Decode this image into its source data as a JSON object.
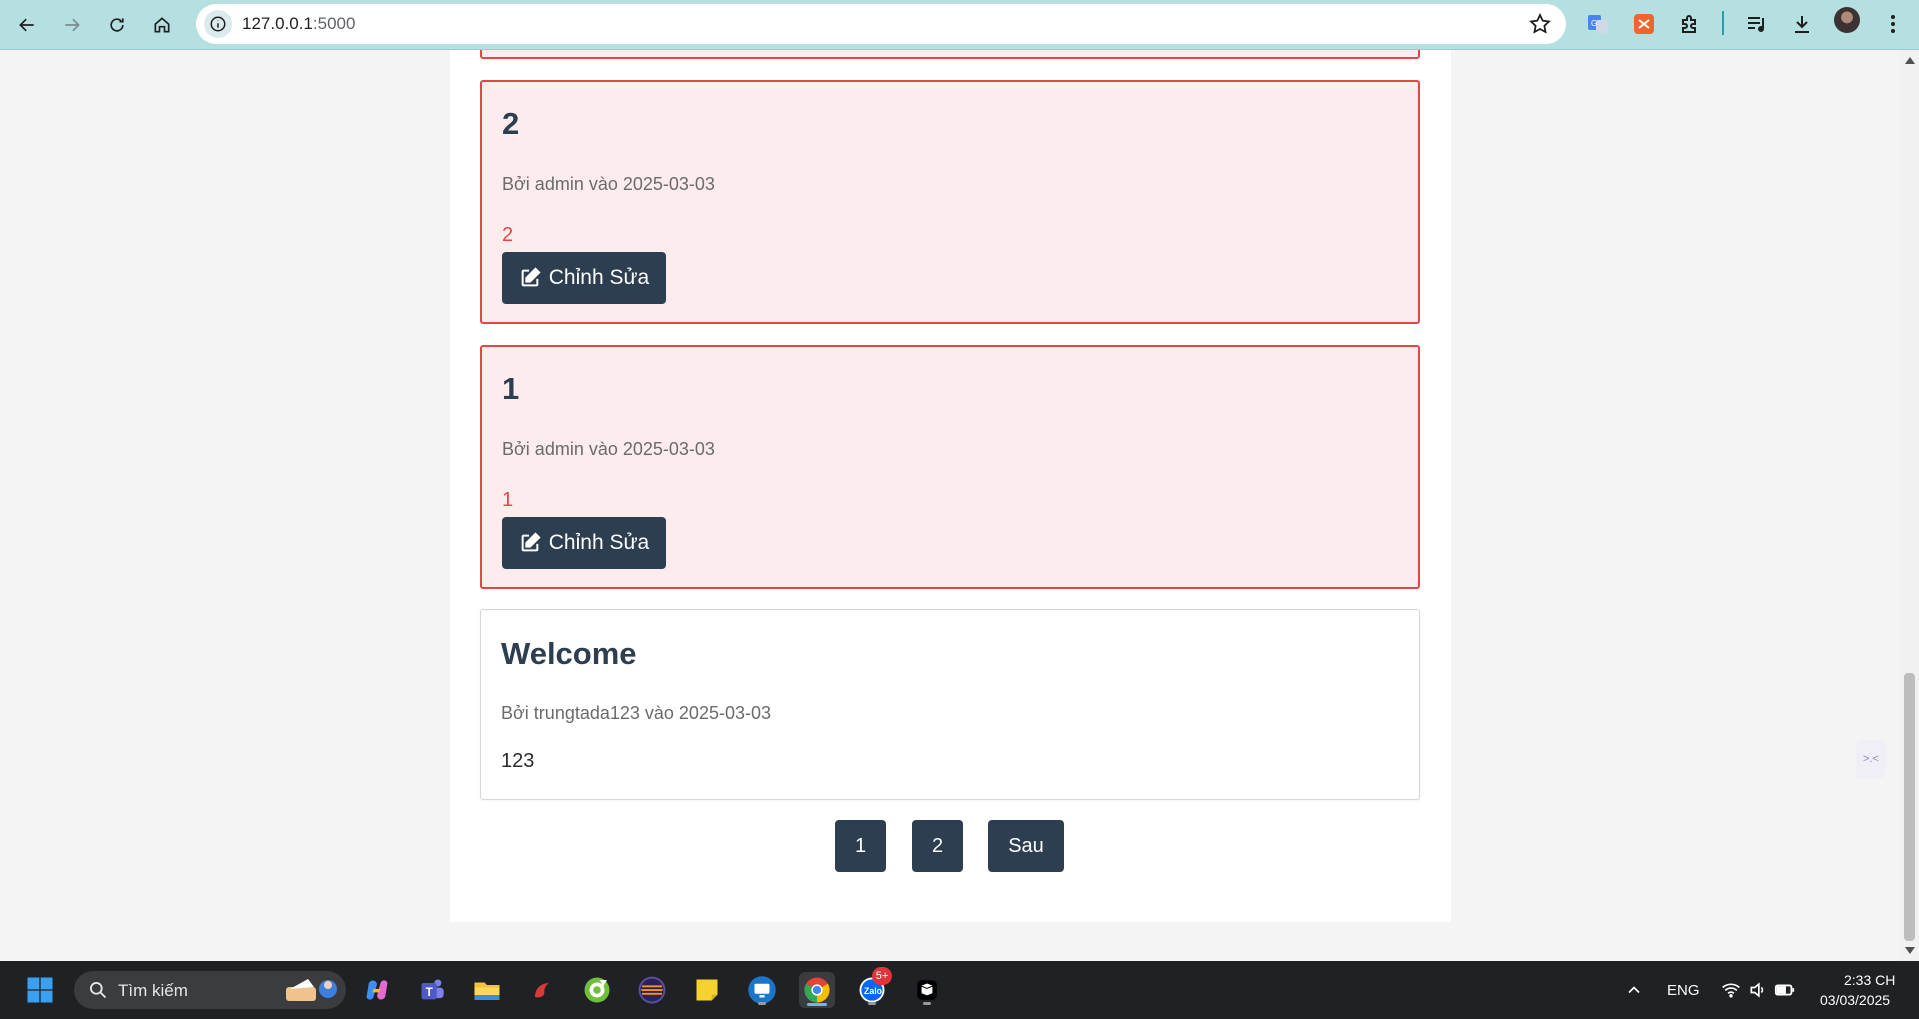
{
  "browser": {
    "url_host": "127.0.0.1",
    "url_port": ":5000"
  },
  "posts": [
    {
      "title": "2",
      "meta": "Bởi admin vào 2025-03-03",
      "content": "2",
      "edit_label": "Chỉnh Sửa"
    },
    {
      "title": "1",
      "meta": "Bởi admin vào 2025-03-03",
      "content": "1",
      "edit_label": "Chỉnh Sửa"
    },
    {
      "title": "Welcome",
      "meta": "Bởi trungtada123 vào 2025-03-03",
      "content": "123"
    }
  ],
  "pagination": {
    "page1": "1",
    "page2": "2",
    "next": "Sau"
  },
  "side_widget": {
    "label": ">.<"
  },
  "taskbar": {
    "search_placeholder": "Tìm kiếm",
    "zalo_badge": "5+",
    "language": "ENG",
    "time": "2:33 CH",
    "date": "03/03/2025"
  },
  "colors": {
    "accent": "#2c3e50",
    "danger_border": "#e04848",
    "danger_bg": "#fdeced",
    "browser_bar": "#b6dfe2"
  }
}
